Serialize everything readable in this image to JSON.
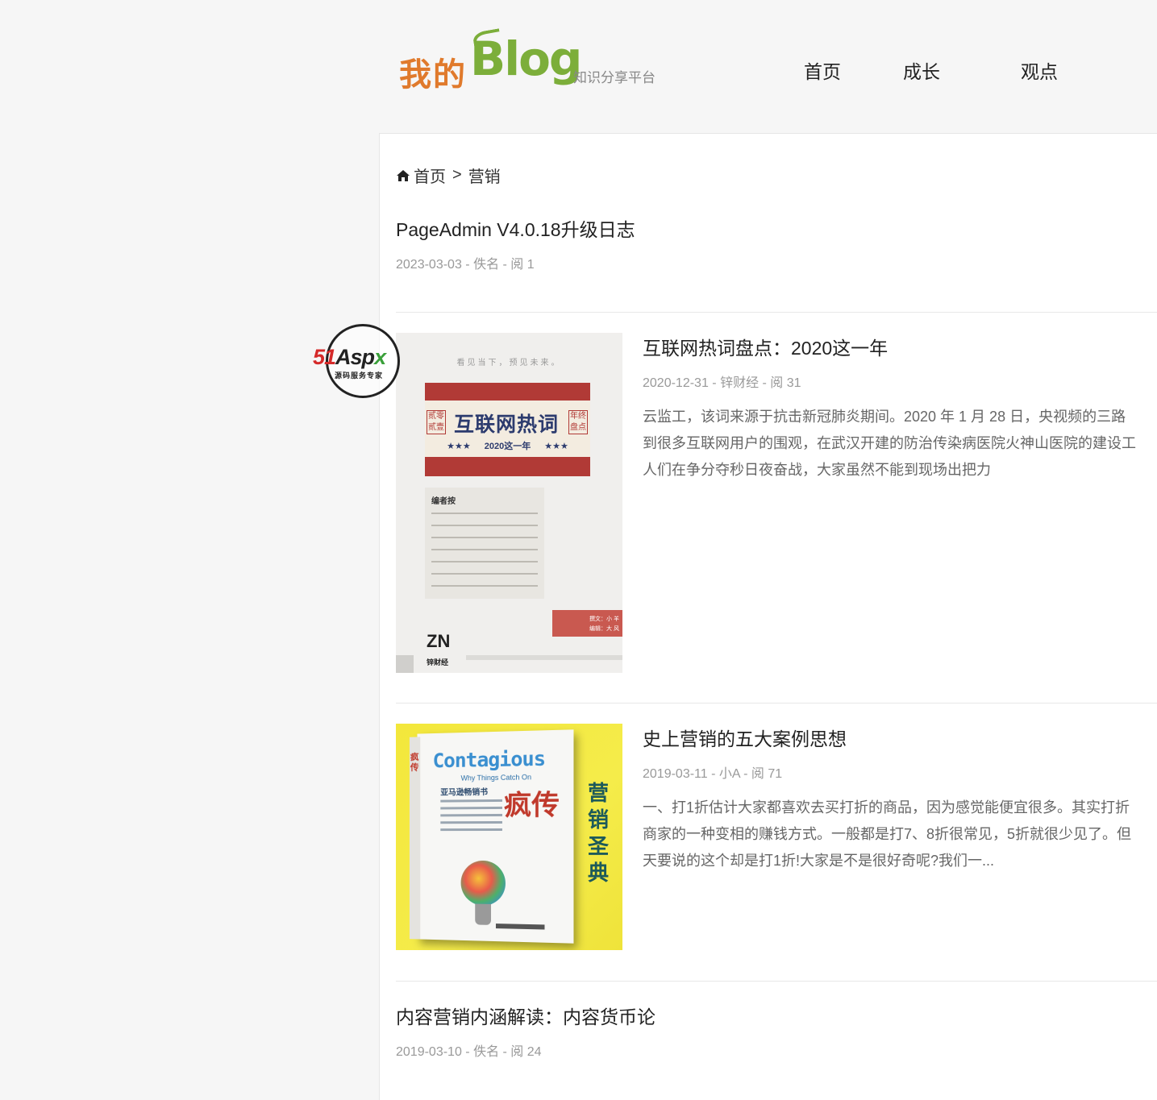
{
  "header": {
    "logo": {
      "cn": "我的",
      "en": "Blog",
      "tagline": "知识分享平台"
    },
    "nav": [
      {
        "label": "首页"
      },
      {
        "label": "成长"
      },
      {
        "label": "观点"
      }
    ]
  },
  "watermark": {
    "brand_prefix": "51",
    "brand_mid": "Asp",
    "brand_suffix": "x",
    "subtitle": "源码服务专家"
  },
  "breadcrumb": {
    "home": "首页",
    "separator": ">",
    "current": "营销"
  },
  "posts": [
    {
      "title": "PageAdmin V4.0.18升级日志",
      "meta": "2023-03-03 - 佚名 - 阅 1"
    },
    {
      "title": "互联网热词盘点：2020这一年",
      "meta": "2020-12-31 - 锌财经 - 阅 31",
      "excerpt": [
        "云监工，该词来源于抗击新冠肺炎期间。2020 年 1 月 28 日，央视频的三路",
        "到很多互联网用户的围观，在武汉开建的防治传染病医院火神山医院的建设工",
        "人们在争分夺秒日夜奋战，大家虽然不能到现场出把力"
      ],
      "thumb": {
        "caption": "看见当下，预见未来。",
        "headline": "互联网热词",
        "subline": "★★★  2020这一年  ★★★",
        "seal_left": "贰零贰壹",
        "seal_right": "年终盘点",
        "note_title": "编者按",
        "credit_1": "撰文：小 羊",
        "credit_2": "编辑：大 风",
        "logo": "ZN",
        "logo_sub": "锌财经"
      }
    },
    {
      "title": "史上营销的五大案例思想",
      "meta": "2019-03-11 - 小A - 阅 71",
      "excerpt": [
        "一、打1折估计大家都喜欢去买打折的商品，因为感觉能便宜很多。其实打折",
        "商家的一种变相的赚钱方式。一般都是打7、8折很常见，5折就很少见了。但",
        "天要说的这个却是打1折!大家是不是很好奇呢?我们一..."
      ],
      "thumb": {
        "title_en": "Contagious",
        "subtitle_en": "Why Things Catch On",
        "title_cn": "疯传",
        "tagline": "亚马逊畅销书",
        "spine": "疯传",
        "side": "营销圣典"
      }
    },
    {
      "title": "内容营销内涵解读：内容货币论",
      "meta": "2019-03-10 - 佚名 - 阅 24"
    }
  ]
}
